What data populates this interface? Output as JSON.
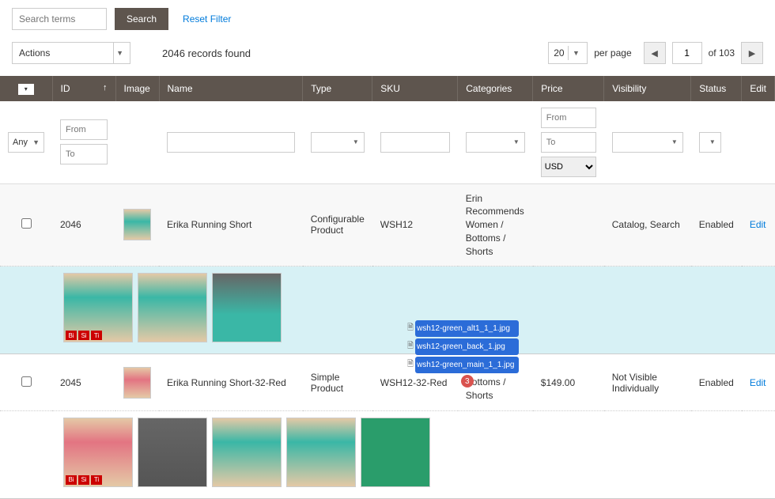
{
  "toolbar": {
    "search_placeholder": "Search terms",
    "search_btn": "Search",
    "reset_link": "Reset Filter"
  },
  "row2": {
    "actions_label": "Actions",
    "records_found": "2046 records found",
    "per_page_value": "20",
    "per_page_label": "per page",
    "page_value": "1",
    "page_of": "of 103"
  },
  "columns": {
    "id": "ID",
    "image": "Image",
    "name": "Name",
    "type": "Type",
    "sku": "SKU",
    "categories": "Categories",
    "price": "Price",
    "visibility": "Visibility",
    "status": "Status",
    "edit": "Edit"
  },
  "filters": {
    "any": "Any",
    "from": "From",
    "to": "To",
    "currency": "USD"
  },
  "rows": [
    {
      "id": "2046",
      "name": "Erika Running Short",
      "type": "Configurable Product",
      "sku": "WSH12",
      "categories": "Erin Recommends\nWomen / Bottoms / Shorts",
      "price": "",
      "visibility": "Catalog, Search",
      "status": "Enabled",
      "edit": "Edit",
      "badges": [
        "Bi",
        "Si",
        "Ti"
      ]
    },
    {
      "id": "2045",
      "name": "Erika Running Short-32-Red",
      "type": "Simple Product",
      "sku": "WSH12-32-Red",
      "categories": "Women / Bottoms / Shorts",
      "price": "$149.00",
      "visibility": "Not Visible Individually",
      "status": "Enabled",
      "edit": "Edit",
      "badges": [
        "Bi",
        "Si",
        "Ti"
      ]
    }
  ],
  "drag": {
    "files": [
      "wsh12-green_alt1_1_1.jpg",
      "wsh12-green_back_1.jpg",
      "wsh12-green_main_1_1.jpg"
    ],
    "count": "3"
  }
}
